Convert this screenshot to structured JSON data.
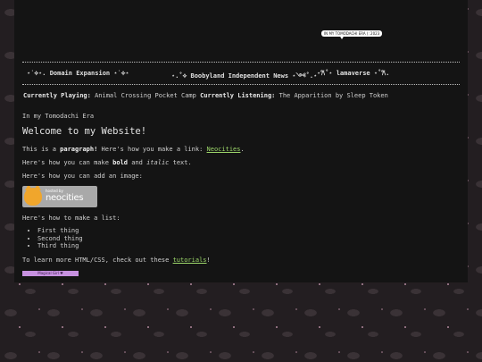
{
  "bubble": {
    "text": "IN MY TOMODACHI ERA (: 2023"
  },
  "nav": {
    "items": [
      {
        "label": "⋆˙⟡⋆. Domain Expansion ⋆˙⟡⋆"
      },
      {
        "label": "⋆.˚⟡ Boobyland Independent News ⋆༺˚.⋆"
      },
      {
        "label": "⋆𐙚˚⋆ lamaverse ⋆˚𐙚."
      }
    ]
  },
  "status": {
    "playing_label": "Currently Playing:",
    "playing_value": "Animal Crossing Pocket Camp",
    "listening_label": "Currently Listening:",
    "listening_value": "The Apparition by Sleep Token"
  },
  "era": "In my Tomodachi Era",
  "main": {
    "title": "Welcome to my Website!",
    "para": {
      "prefix": "This is a ",
      "bold": "paragraph!",
      "middle": " Here's how you make a link: ",
      "link": "Neocities",
      "suffix": "."
    },
    "format": {
      "prefix": "Here's how you can make ",
      "bold": "bold",
      "and": " and ",
      "italic": "italic",
      "suffix": " text."
    },
    "image_line": "Here's how you can add an image:",
    "badge": {
      "hosted": "hosted by",
      "brand": "neocities"
    },
    "list_intro": "Here's how to make a list:",
    "list_items": [
      "First thing",
      "Second thing",
      "Third thing"
    ],
    "learn": {
      "prefix": "To learn more HTML/CSS, check out these ",
      "link": "tutorials",
      "suffix": "!"
    },
    "tiny_badge": "Magical Girl ♥"
  },
  "colors": {
    "link": "#9cd66a",
    "background": "#231e21",
    "panel": "#141414"
  }
}
